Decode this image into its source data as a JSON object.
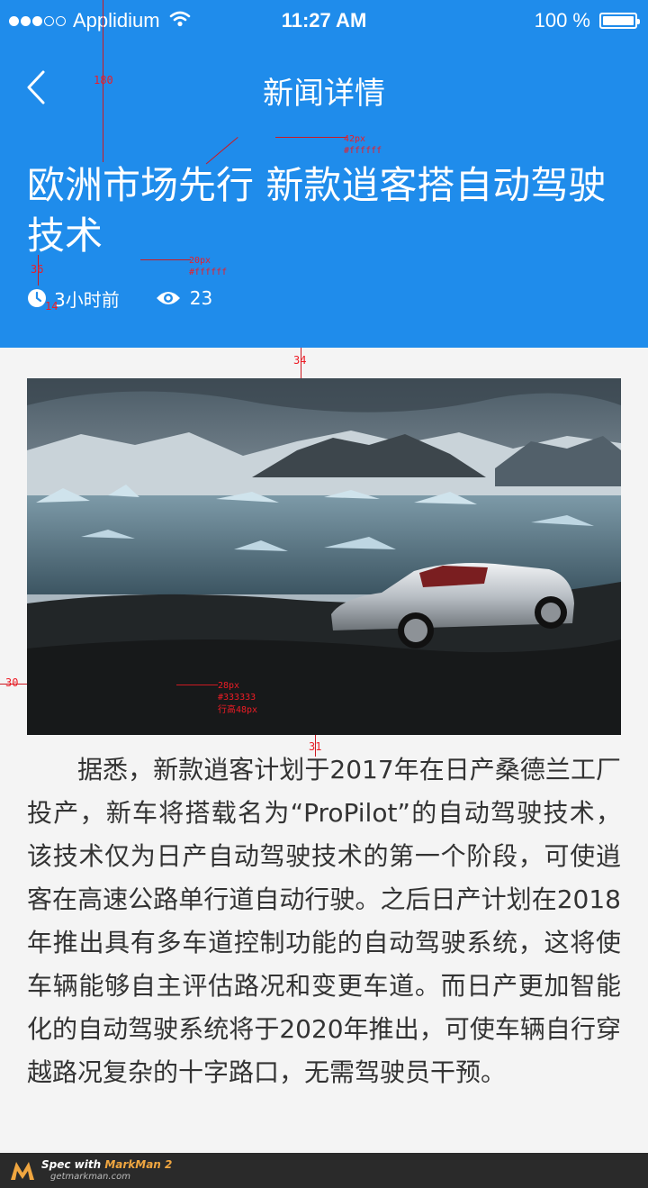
{
  "status_bar": {
    "carrier": "Applidium",
    "time": "11:27 AM",
    "battery": "100 %",
    "signal_bars_filled": 3,
    "signal_bars_total": 5
  },
  "nav": {
    "title": "新闻详情",
    "back_icon": "chevron-left-icon"
  },
  "article": {
    "headline": "欧洲市场先行 新款逍客搭自动驾驶技术",
    "time_ago": "3小时前",
    "views": "23",
    "body": "据悉，新款逍客计划于2017年在日产桑德兰工厂投产，新车将搭载名为“ProPilot”的自动驾驶技术，该技术仅为日产自动驾驶技术的第一个阶段，可使逍客在高速公路单行道自动行驶。之后日产计划在2018年推出具有多车道控制功能的自动驾驶系统，这将使车辆能够自主评估路况和变更车道。而日产更加智能化的自动驾驶系统将于2020年推出，可使车辆自行穿越路况复杂的十字路口，无需驾驶员干预。"
  },
  "colors": {
    "header_bg": "#1f8ceb",
    "page_bg": "#f4f4f4",
    "headline": "#ffffff",
    "body_text": "#333333",
    "annotation": "#ee1c25"
  },
  "annotations": {
    "header_height": "180",
    "headline_size": "42px",
    "headline_color": "#ffffff",
    "meta_gap": "36",
    "meta_size": "20px",
    "meta_color": "#ffffff",
    "icon_size": "14",
    "image_gap": "34",
    "side_margin": "30",
    "body_size": "28px",
    "body_color": "#333333",
    "body_line_height": "行高48px",
    "body_gap": "31"
  },
  "footer": {
    "prefix": "Spec with ",
    "brand": "MarkMan 2",
    "url": "getmarkman.com"
  }
}
